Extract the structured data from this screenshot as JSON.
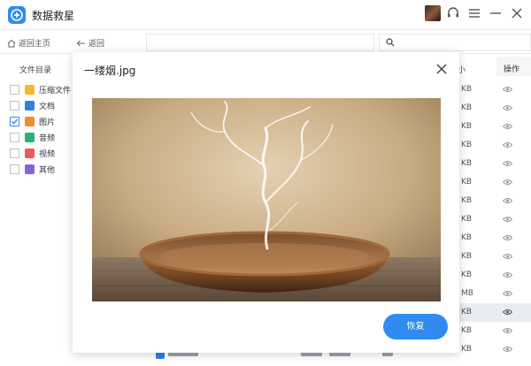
{
  "app": {
    "title": "数据救星"
  },
  "toolbar": {
    "home_label": "返回主页",
    "back_label": "返回"
  },
  "sidebar": {
    "title": "文件目录",
    "items": [
      {
        "label": "压缩文件",
        "checked": false,
        "icon": "archive-icon",
        "color": "#f5b730"
      },
      {
        "label": "文档",
        "checked": false,
        "icon": "document-icon",
        "color": "#2f7fe8"
      },
      {
        "label": "图片",
        "checked": true,
        "icon": "image-icon",
        "color": "#f08c2c"
      },
      {
        "label": "音频",
        "checked": false,
        "icon": "audio-icon",
        "color": "#2cb07a"
      },
      {
        "label": "视频",
        "checked": false,
        "icon": "video-icon",
        "color": "#ea5a5a"
      },
      {
        "label": "其他",
        "checked": false,
        "icon": "other-icon",
        "color": "#8a63d8"
      }
    ]
  },
  "table": {
    "size_header_fragment": "小",
    "op_header": "操作",
    "size_fragments": [
      "KB",
      "KB",
      "KB",
      "KB",
      "KB",
      "KB",
      "KB",
      "KB",
      "KB",
      "KB",
      "KB",
      "MB",
      "KB",
      "KB",
      "KB"
    ]
  },
  "modal": {
    "title": "一缕烟.jpg",
    "restore_label": "恢复"
  },
  "colors": {
    "accent": "#2f8bf0",
    "row_highlight": "#e9ecf2"
  }
}
